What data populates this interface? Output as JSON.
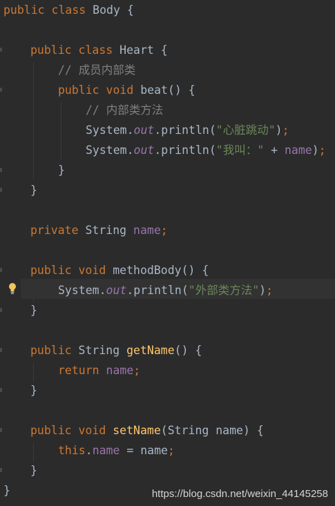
{
  "editor": {
    "lines": {
      "class_body": {
        "kw1": "public",
        "kw2": "class",
        "name": "Body",
        "brace": "{"
      },
      "class_heart": {
        "kw1": "public",
        "kw2": "class",
        "name": "Heart",
        "brace": "{"
      },
      "comment_member": "// 成员内部类",
      "beat_decl": {
        "kw1": "public",
        "kw2": "void",
        "name": "beat",
        "parens": "()",
        "brace": "{"
      },
      "comment_method": "// 内部类方法",
      "println1": {
        "system": "System.",
        "out": "out",
        "call": ".println(",
        "str": "\"心脏跳动\"",
        "close": ")",
        "semi": ";"
      },
      "println2": {
        "system": "System.",
        "out": "out",
        "call": ".println(",
        "str": "\"我叫：\"",
        "plus": " + ",
        "var": "name",
        "close": ")",
        "semi": ";"
      },
      "close_beat": "}",
      "close_heart": "}",
      "field": {
        "kw": "private",
        "type": "String",
        "name": "name",
        "semi": ";"
      },
      "methodbody_decl": {
        "kw1": "public",
        "kw2": "void",
        "name": "methodBody",
        "parens": "()",
        "brace": "{"
      },
      "println3": {
        "system": "System.",
        "out": "out",
        "call": ".println(",
        "str": "\"外部类方法\"",
        "close": ")",
        "semi": ";"
      },
      "close_methodbody": "}",
      "getname_decl": {
        "kw": "public",
        "type": "String",
        "name": "getName",
        "parens": "()",
        "brace": "{"
      },
      "return_stmt": {
        "kw": "return",
        "var": "name",
        "semi": ";"
      },
      "close_getname": "}",
      "setname_decl": {
        "kw1": "public",
        "kw2": "void",
        "name": "setName",
        "params": "(String name)",
        "brace": "{"
      },
      "assign_stmt": {
        "kw": "this",
        "dot": ".",
        "field": "name",
        "eq": " = name",
        "semi": ";"
      },
      "close_setname": "}",
      "close_body": "}"
    }
  },
  "watermark": "https://blog.csdn.net/weixin_44145258",
  "icons": {
    "intention": "lightbulb-icon"
  },
  "colors": {
    "background": "#2b2b2b",
    "keyword": "#cc7832",
    "string": "#6a8759",
    "field": "#9876aa",
    "method_decl": "#ffc66d",
    "comment": "#808080",
    "default": "#a9b7c6"
  }
}
